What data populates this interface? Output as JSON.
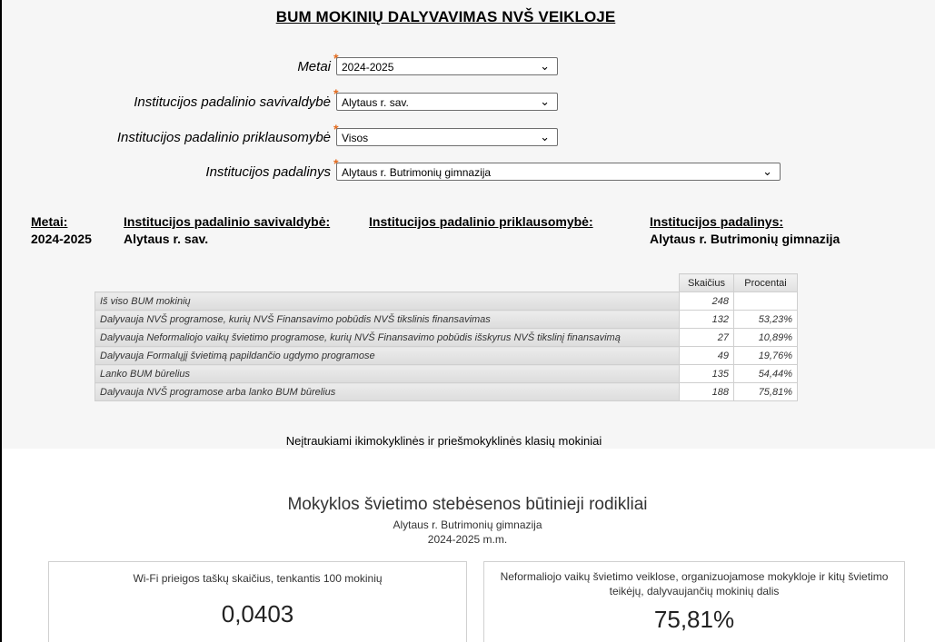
{
  "page_title": "BUM MOKINIŲ DALYVAVIMAS NVŠ VEIKLOJE",
  "filters": [
    {
      "label": "Metai",
      "value": "2024-2025"
    },
    {
      "label": "Institucijos padalinio savivaldybė",
      "value": "Alytaus r. sav."
    },
    {
      "label": "Institucijos padalinio priklausomybė",
      "value": "Visos"
    },
    {
      "label": "Institucijos padalinys",
      "value": "Alytaus r. Butrimonių gimnazija"
    }
  ],
  "required_marker": "*",
  "summary": {
    "metai_label": "Metai:",
    "metai_value": "2024-2025",
    "savivaldybe_label": "Institucijos padalinio savivaldybė:",
    "savivaldybe_value": "Alytaus r. sav.",
    "priklausomybe_label": "Institucijos padalinio priklausomybė:",
    "padalinys_label": "Institucijos padalinys:",
    "padalinys_value": "Alytaus r. Butrimonių gimnazija"
  },
  "table": {
    "headers": [
      "Skaičius",
      "Procentai"
    ],
    "rows": [
      {
        "label": "Iš viso BUM mokinių",
        "count": "248",
        "percent": ""
      },
      {
        "label": "Dalyvauja NVŠ programose, kurių NVŠ Finansavimo pobūdis NVŠ tikslinis finansavimas",
        "count": "132",
        "percent": "53,23%"
      },
      {
        "label": "Dalyvauja Neformaliojo vaikų švietimo programose, kurių NVŠ Finansavimo pobūdis išskyrus NVŠ tikslinį finansavimą",
        "count": "27",
        "percent": "10,89%"
      },
      {
        "label": "Dalyvauja Formalųjį švietimą papildančio ugdymo programose",
        "count": "49",
        "percent": "19,76%"
      },
      {
        "label": "Lanko BUM būrelius",
        "count": "135",
        "percent": "54,44%"
      },
      {
        "label": "Dalyvauja NVŠ programose arba lanko BUM būrelius",
        "count": "188",
        "percent": "75,81%"
      }
    ]
  },
  "footnote": "Neįtraukiami ikimokyklinės ir priešmokyklinės klasių mokiniai",
  "dashboard": {
    "title": "Mokyklos švietimo stebėsenos būtinieji rodikliai",
    "school": "Alytaus r. Butrimonių gimnazija",
    "year": "2024-2025 m.m.",
    "cards": [
      {
        "title": "Wi-Fi prieigos taškų skaičius, tenkantis 100 mokinių",
        "value": "0,0403"
      },
      {
        "title": "Neformaliojo vaikų švietimo veiklose, organizuojamose mokykloje ir kitų švietimo teikėjų, dalyvaujančių mokinių dalis",
        "value": "75,81%"
      }
    ]
  },
  "colors": {
    "required_marker": "#e46a1c",
    "panel_background": "#f6f6f6"
  },
  "icons": {
    "dropdown": "chevron-down-icon"
  }
}
